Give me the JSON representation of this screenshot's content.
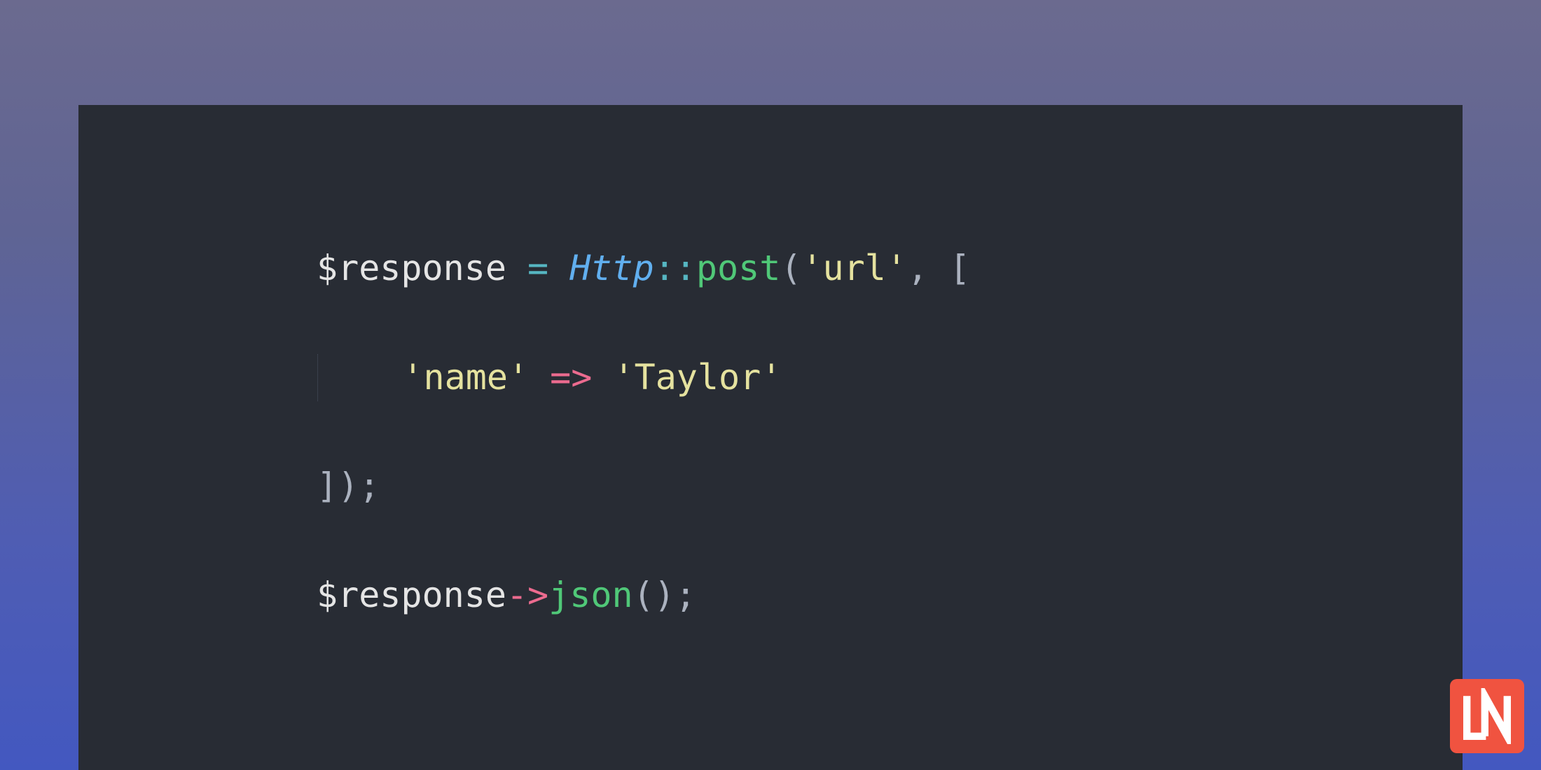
{
  "code": {
    "line1": {
      "var": "$response",
      "space1": " ",
      "eq": "=",
      "space2": " ",
      "class": "Http",
      "scope": "::",
      "method": "post",
      "open": "(",
      "str1": "'url'",
      "comma": ", [",
      "end": ""
    },
    "line2": {
      "indent": "    ",
      "key": "'name'",
      "sp1": " ",
      "arrow": "=>",
      "sp2": " ",
      "val": "'Taylor'"
    },
    "line3": {
      "close": "]);"
    },
    "line4": {
      "var": "$response",
      "thin": "->",
      "method": "json",
      "call": "();"
    }
  },
  "logo": {
    "text": "LN"
  }
}
